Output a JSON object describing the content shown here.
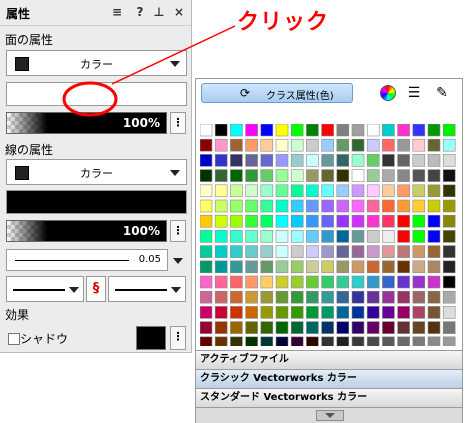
{
  "annotation": {
    "label": "クリック",
    "color": "#ff0000"
  },
  "panel": {
    "title": "属性",
    "controls": {
      "menu": "≡",
      "help": "?",
      "pin": "⊥",
      "close": "×"
    },
    "fill_section": "面の属性",
    "fill_style": "カラー",
    "fill_opacity": "100%",
    "line_section": "線の属性",
    "line_style": "カラー",
    "line_opacity": "100%",
    "line_thickness": "0.05",
    "effects_section": "効果",
    "shadow_label": "シャドウ",
    "kebab": "⋮",
    "chain_icon": "chain-link-icon"
  },
  "palette": {
    "class_button": "クラス属性(色)",
    "icons": [
      "color-wheel-icon",
      "list-view-icon",
      "palette-tools-icon"
    ],
    "lists": [
      "アクティブファイル",
      "クラシック Vectorworks カラー",
      "スタンダード Vectorworks カラー"
    ],
    "selected_list": "クラシック Vectorworks カラー",
    "colors": [
      [
        "#ffffff",
        "#000000",
        "#00ffff",
        "#ff00ff",
        "#0000ff",
        "#ffff00",
        "#00ff00",
        "#008000",
        "#ff0000",
        "#808080",
        "#a0a0a0",
        "#ffffff",
        "#00cccc",
        "#ff33cc",
        "#3333ff",
        "#009900",
        "#00ee00"
      ],
      [
        "#8b0000",
        "#ff99cc",
        "#996633",
        "#ff9966",
        "#ffcc99",
        "#ffffcc",
        "#ccffcc",
        "#cccccc",
        "#99ccff",
        "#669966",
        "#336633",
        "#ccccff",
        "#ff6666",
        "#999999",
        "#ffcccc",
        "#666633",
        "#99ffff"
      ],
      [
        "#0000cc",
        "#3333cc",
        "#333366",
        "#666699",
        "#6666cc",
        "#9999ff",
        "#99cccc",
        "#ccffff",
        "#669999",
        "#336666",
        "#99ffcc",
        "#66cc66",
        "#333333",
        "#666666",
        "#cccccc",
        "#bbbbbb",
        "#dddddd"
      ],
      [
        "#003300",
        "#336633",
        "#006600",
        "#339933",
        "#66cc66",
        "#99ff99",
        "#ccffcc",
        "#999966",
        "#666633",
        "#333300",
        "#ffffff",
        "#99cc99",
        "#aaaaaa",
        "#888888",
        "#555555",
        "#444444",
        "#111111"
      ],
      [
        "#ffffcc",
        "#ffff99",
        "#ccff99",
        "#ccffcc",
        "#99ffcc",
        "#66ff99",
        "#00ff99",
        "#00ffcc",
        "#66ffff",
        "#99ccff",
        "#cc99ff",
        "#ffccff",
        "#ffcc99",
        "#ff9966",
        "#cccc66",
        "#999933",
        "#333300"
      ],
      [
        "#ffff66",
        "#ccff66",
        "#99ff66",
        "#66ff66",
        "#33ff99",
        "#00ffcc",
        "#33ccff",
        "#6699ff",
        "#9966ff",
        "#cc66ff",
        "#ff66ff",
        "#ff6699",
        "#ff6633",
        "#ff9933",
        "#ffcc33",
        "#cccc00",
        "#999900"
      ],
      [
        "#ffcc00",
        "#ccff00",
        "#99ff00",
        "#33ff33",
        "#00ff66",
        "#00ffff",
        "#00ccff",
        "#3399ff",
        "#6666ff",
        "#9933ff",
        "#cc33ff",
        "#ff33cc",
        "#ff3366",
        "#ff0000",
        "#00ff00",
        "#0000ff",
        "#888800"
      ],
      [
        "#00ff99",
        "#00ffcc",
        "#33ffcc",
        "#66ffcc",
        "#99ffcc",
        "#ccffff",
        "#99ffff",
        "#66ccff",
        "#3399cc",
        "#006699",
        "#669999",
        "#cccccc",
        "#eeeeee",
        "#ff0000",
        "#00ff00",
        "#0000ff",
        "#444400"
      ],
      [
        "#00cc99",
        "#00cccc",
        "#33cccc",
        "#66cccc",
        "#99cccc",
        "#ccffff",
        "#cccccc",
        "#ccccff",
        "#9999cc",
        "#666699",
        "#996699",
        "#cc99cc",
        "#dd9999",
        "#bb7777",
        "#cc9966",
        "#996633",
        "#333333"
      ],
      [
        "#009966",
        "#009999",
        "#339999",
        "#669999",
        "#669966",
        "#99cc99",
        "#99cc66",
        "#cccc99",
        "#cccc66",
        "#999966",
        "#cc9966",
        "#cc6633",
        "#996633",
        "#663300",
        "#ccaa88",
        "#aa8866",
        "#222222"
      ],
      [
        "#ff66cc",
        "#ff6699",
        "#ff6666",
        "#ff9966",
        "#ffcc66",
        "#cccc33",
        "#99cc33",
        "#66cc33",
        "#33cc66",
        "#33cc99",
        "#33cccc",
        "#3399cc",
        "#3366cc",
        "#6633cc",
        "#9933cc",
        "#cc33cc",
        "#000000"
      ],
      [
        "#cc6699",
        "#cc6666",
        "#cc6633",
        "#cc9933",
        "#999933",
        "#669933",
        "#339933",
        "#339966",
        "#339999",
        "#336699",
        "#333399",
        "#663399",
        "#993399",
        "#993366",
        "#996666",
        "#886644",
        "#aaaaaa"
      ],
      [
        "#cc0066",
        "#cc0033",
        "#cc3300",
        "#cc6600",
        "#999900",
        "#669900",
        "#339900",
        "#009933",
        "#009966",
        "#006699",
        "#003399",
        "#330099",
        "#660099",
        "#990066",
        "#aa4466",
        "#775533",
        "#dddddd"
      ],
      [
        "#990033",
        "#993300",
        "#996600",
        "#666600",
        "#336600",
        "#006600",
        "#006633",
        "#006666",
        "#003366",
        "#000066",
        "#330066",
        "#660066",
        "#660033",
        "#663333",
        "#664422",
        "#553311",
        "#777777"
      ],
      [
        "#660000",
        "#663300",
        "#333300",
        "#003300",
        "#003333",
        "#000033",
        "#330033",
        "#330000",
        "#333333",
        "#222222",
        "#3a3a3a",
        "#4a4a4a",
        "#5a5a5a",
        "#6a6a6a",
        "#7a7a7a",
        "#8a8a8a",
        "#999999"
      ]
    ]
  }
}
